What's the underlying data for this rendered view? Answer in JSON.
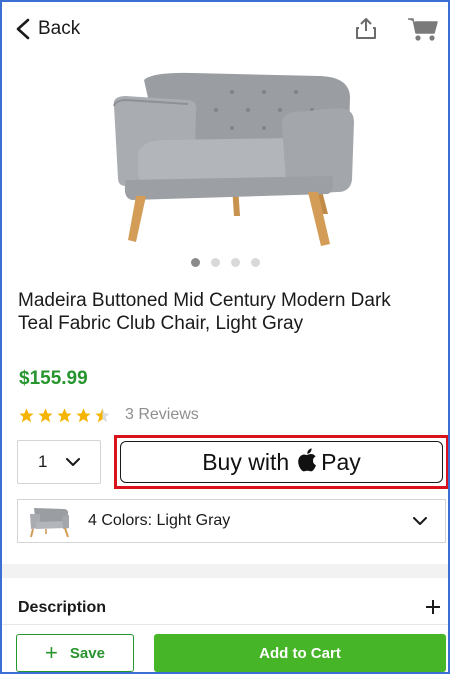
{
  "nav": {
    "back_label": "Back"
  },
  "product": {
    "title": "Madeira Buttoned Mid Century Modern Dark Teal Fabric Club Chair, Light Gray",
    "price": "$155.99",
    "rating": 4.5,
    "reviews_label": "3 Reviews",
    "image_count": 4,
    "active_image_index": 0
  },
  "purchase": {
    "quantity": "1",
    "applepay_label": "Buy with",
    "applepay_suffix": "Pay"
  },
  "variant": {
    "colors_label": "4 Colors:",
    "selected_color": "Light Gray"
  },
  "section": {
    "description_label": "Description"
  },
  "bottom": {
    "save_label": "Save",
    "add_to_cart_label": "Add to Cart"
  },
  "colors": {
    "price_green": "#27952e",
    "button_green": "#46b628",
    "star_gold": "#f5b400",
    "highlight_red": "#d9121b"
  }
}
